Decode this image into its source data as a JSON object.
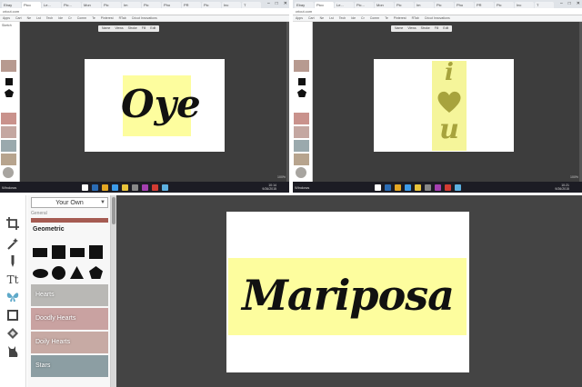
{
  "screens": {
    "top_left": {
      "tabs": [
        "Ebay",
        "Pico",
        "Le...",
        "Pic...",
        "Mon",
        "Pic",
        "Im",
        "Pic",
        "Pho",
        "PR",
        "Pic",
        "Inc",
        "T"
      ],
      "address": "cricut.com",
      "bookmarks": [
        "Apps",
        "Cart",
        "Ne",
        "Lst",
        "Tech",
        "Ide",
        "Cr",
        "Comm",
        "Te",
        "Pinterest",
        "RTab",
        "Cricut Innovations"
      ],
      "sidebar_title": "Sketch",
      "toolbar_items": [
        "Name",
        "Views",
        "Stroke",
        "Fill",
        "Edit"
      ],
      "design_text": "Oye",
      "taskbar_label": "Windows",
      "tray_time": "10:14",
      "tray_date": "9/26/2015",
      "zoom": "100%"
    },
    "top_right": {
      "tabs": [
        "Ebay",
        "Pico",
        "Le...",
        "Pic...",
        "Mon",
        "Pic",
        "Im",
        "Pic",
        "Pho",
        "PR",
        "Pic",
        "Inc",
        "T"
      ],
      "address": "cricut.com",
      "bookmarks": [
        "Apps",
        "Cart",
        "Ne",
        "Lst",
        "Tech",
        "Ide",
        "Cr",
        "Comm",
        "Te",
        "Pinterest",
        "RTab",
        "Cricut Innovations"
      ],
      "toolbar_items": [
        "Name",
        "Views",
        "Stroke",
        "Fill",
        "Edit"
      ],
      "design_letters": [
        "i",
        "u"
      ],
      "taskbar_label": "Windows",
      "tray_time": "10:21",
      "tray_date": "9/26/2015",
      "zoom": "100%"
    },
    "bottom": {
      "dropdown_value": "Your Own",
      "general_label": "General",
      "section_title": "Geometric",
      "categories": [
        "Hearts",
        "Doodly Hearts",
        "Doily Hearts",
        "Stars"
      ],
      "design_text": "Mariposa"
    }
  },
  "colors": {
    "highlight_yellow": "#fdfd9e",
    "olive_heart": "#a7a33d",
    "workspace": "#3d3d3d",
    "hearts_tint": "#b9b8b5",
    "doodly_tint": "#c9a2a1",
    "doily_tint": "#c7aaa4",
    "stars_tint": "#8c9ea3"
  },
  "icons": [
    "crop-icon",
    "magic-wand-icon",
    "pen-icon",
    "text-icon",
    "butterfly-icon",
    "frame-icon",
    "pattern-icon",
    "cat-icon"
  ]
}
